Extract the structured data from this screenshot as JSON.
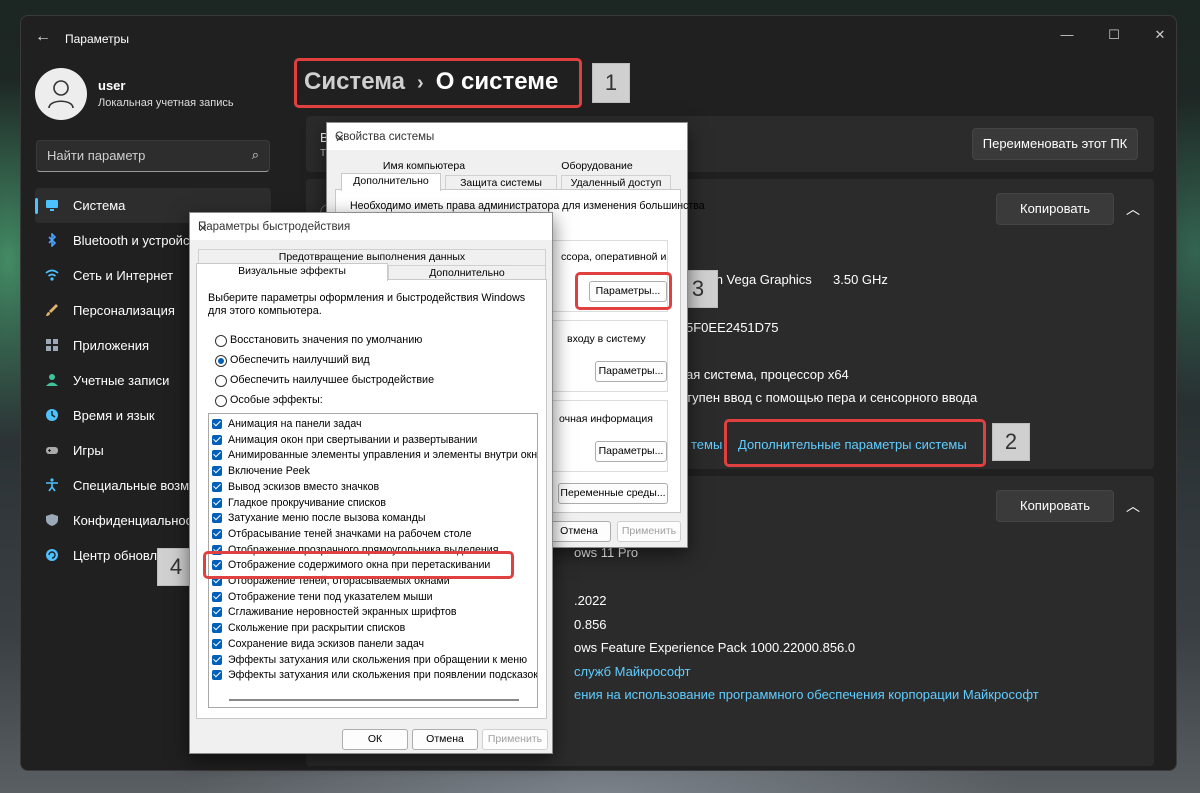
{
  "settings": {
    "title": "Параметры",
    "user": {
      "name": "user",
      "subtitle": "Локальная учетная запись"
    },
    "search": {
      "placeholder": "Найти параметр"
    },
    "nav": [
      {
        "label": "Система",
        "icon": "monitor-icon",
        "color": "#4cc2ff"
      },
      {
        "label": "Bluetooth и устройства",
        "icon": "bluetooth-icon",
        "color": "#4aa3ff"
      },
      {
        "label": "Сеть и Интернет",
        "icon": "wifi-icon",
        "color": "#4cc2ff"
      },
      {
        "label": "Персонализация",
        "icon": "brush-icon",
        "color": "#e0b36a"
      },
      {
        "label": "Приложения",
        "icon": "apps-icon",
        "color": "#9aa8b8"
      },
      {
        "label": "Учетные записи",
        "icon": "person-icon",
        "color": "#3fc39a"
      },
      {
        "label": "Время и язык",
        "icon": "globe-clock-icon",
        "color": "#4cc2ff"
      },
      {
        "label": "Игры",
        "icon": "gamepad-icon",
        "color": "#aaaaaa"
      },
      {
        "label": "Специальные возможности",
        "icon": "accessibility-icon",
        "color": "#4cc2ff"
      },
      {
        "label": "Конфиденциальность и защита",
        "icon": "shield-icon",
        "color": "#9aa8b8"
      },
      {
        "label": "Центр обновления Windows",
        "icon": "update-icon",
        "color": "#4cc2ff"
      }
    ],
    "breadcrumb": {
      "part1": "Система",
      "separator": "›",
      "part2": "О системе"
    },
    "top_card": {
      "peek_line1": "В",
      "peek_line2": "Т",
      "rename_button": "Переименовать этот ПК"
    },
    "device_card": {
      "copy_button": "Копировать",
      "processor_tail": "deon Vega Graphics",
      "processor_freq": "3.50 GHz",
      "device_id_tail": "5F0EE2451D75",
      "system_type_tail": "ая система, процессор x64",
      "pen_tail": "тупен ввод с помощью пера и сенсорного ввода",
      "related_link_tail": "темы",
      "advanced_link": "Дополнительные параметры системы"
    },
    "windows_card": {
      "copy_button": "Копировать",
      "edition_tail": "ows 11 Pro",
      "date_tail": ".2022",
      "build_tail": "0.856",
      "experience_tail": "ows Feature Experience Pack 1000.22000.856.0",
      "link1_tail": "служб Майкрософт",
      "link2_tail": "ения на использование программного обеспечения корпорации Майкрософт"
    }
  },
  "badges": {
    "b1": "1",
    "b2": "2",
    "b3": "3",
    "b4": "4"
  },
  "sysprops": {
    "title": "Свойства системы",
    "tabs_row1": [
      "Имя компьютера",
      "Оборудование"
    ],
    "tabs_row2": [
      "Дополнительно",
      "Защита системы",
      "Удаленный доступ"
    ],
    "admin_note": "Необходимо иметь права администратора для изменения большинства",
    "perf_group_tail": "ссора, оперативной и",
    "profile_group_tail": "входу в систему",
    "startup_group_tail": "очная информация",
    "params_button": "Параметры...",
    "env_button": "Переменные среды...",
    "cancel_button": "Отмена",
    "apply_button": "Применить"
  },
  "perfdlg": {
    "title": "Параметры быстродействия",
    "tab_top": "Предотвращение выполнения данных",
    "tab_visual": "Визуальные эффекты",
    "tab_advanced": "Дополнительно",
    "description": "Выберите параметры оформления и быстродействия Windows для этого компьютера.",
    "radios": [
      {
        "label": "Восстановить значения по умолчанию",
        "selected": false
      },
      {
        "label": "Обеспечить наилучший вид",
        "selected": true
      },
      {
        "label": "Обеспечить наилучшее быстродействие",
        "selected": false
      },
      {
        "label": "Особые эффекты:",
        "selected": false
      }
    ],
    "effects": [
      "Анимация на панели задач",
      "Анимация окон при свертывании и развертывании",
      "Анимированные элементы управления и элементы внутри окна",
      "Включение Peek",
      "Вывод эскизов вместо значков",
      "Гладкое прокручивание списков",
      "Затухание меню после вызова команды",
      "Отбрасывание теней значками на рабочем столе",
      "Отображение прозрачного прямоугольника выделения",
      "Отображение содержимого окна при перетаскивании",
      "Отображение теней, отбрасываемых окнами",
      "Отображение тени под указателем мыши",
      "Сглаживание неровностей экранных шрифтов",
      "Скольжение при раскрытии списков",
      "Сохранение вида эскизов панели задач",
      "Эффекты затухания или скольжения при обращении к меню",
      "Эффекты затухания или скольжения при появлении подсказок"
    ],
    "ok_button": "ОК",
    "cancel_button": "Отмена",
    "apply_button": "Применить"
  },
  "colors": {
    "accent": "#4cc2ff",
    "link": "#60cdff",
    "highlight": "#e04040",
    "check": "#005fb8"
  }
}
